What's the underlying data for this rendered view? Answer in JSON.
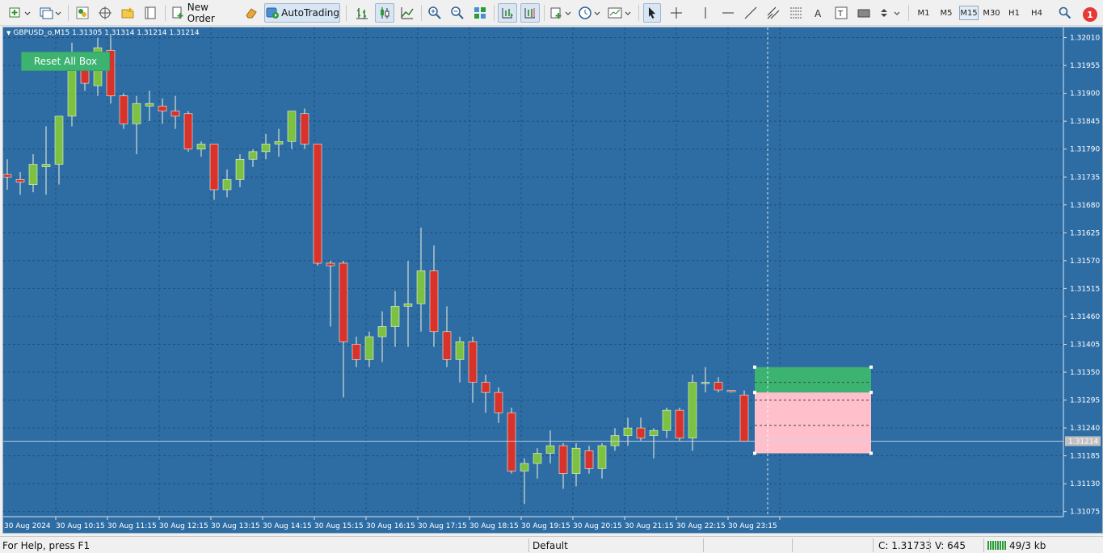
{
  "toolbar": {
    "new_order_label": "New Order",
    "autotrading_label": "AutoTrading",
    "timeframes": [
      "M1",
      "M5",
      "M15",
      "M30",
      "H1",
      "H4"
    ],
    "active_timeframe": "M15",
    "alert_count": "1"
  },
  "chart": {
    "symbol_info": "GBPUSD_o,M15  1.31305 1.31314 1.31214 1.31214",
    "reset_button_label": "Reset All Box",
    "current_price_label": "1.31214",
    "colors": {
      "background": "#2e6da4",
      "bull": "#7cc242",
      "bear": "#d9322b",
      "grid": "#1f4e7a",
      "tp_box": "#3cb371",
      "sl_box": "#ffc0cb"
    }
  },
  "status": {
    "help": "For Help, press F1",
    "profile": "Default",
    "close": "C: 1.31733",
    "volume": "V: 645",
    "traffic": "49/3 kb"
  },
  "chart_data": {
    "type": "candlestick",
    "symbol": "GBPUSD_o",
    "timeframe": "M15",
    "y_ticks": [
      "1.32010",
      "1.31955",
      "1.31900",
      "1.31845",
      "1.31790",
      "1.31735",
      "1.31680",
      "1.31625",
      "1.31570",
      "1.31515",
      "1.31460",
      "1.31405",
      "1.31350",
      "1.31295",
      "1.31240",
      "1.31185",
      "1.31130",
      "1.31075"
    ],
    "x_ticks": [
      "30 Aug 2024",
      "30 Aug 10:15",
      "30 Aug 11:15",
      "30 Aug 12:15",
      "30 Aug 13:15",
      "30 Aug 14:15",
      "30 Aug 15:15",
      "30 Aug 16:15",
      "30 Aug 17:15",
      "30 Aug 18:15",
      "30 Aug 19:15",
      "30 Aug 20:15",
      "30 Aug 21:15",
      "30 Aug 22:15",
      "30 Aug 23:15"
    ],
    "ylim": [
      1.3107,
      1.3202
    ],
    "candles": [
      {
        "o": 1.3174,
        "h": 1.3177,
        "l": 1.3171,
        "c": 1.31735
      },
      {
        "o": 1.3173,
        "h": 1.31745,
        "l": 1.317,
        "c": 1.31725
      },
      {
        "o": 1.3172,
        "h": 1.3178,
        "l": 1.31705,
        "c": 1.3176
      },
      {
        "o": 1.31755,
        "h": 1.31835,
        "l": 1.317,
        "c": 1.3176
      },
      {
        "o": 1.3176,
        "h": 1.3184,
        "l": 1.3172,
        "c": 1.31855
      },
      {
        "o": 1.31855,
        "h": 1.32,
        "l": 1.31835,
        "c": 1.3196
      },
      {
        "o": 1.3196,
        "h": 1.3197,
        "l": 1.31905,
        "c": 1.3192
      },
      {
        "o": 1.31915,
        "h": 1.3201,
        "l": 1.31895,
        "c": 1.3199
      },
      {
        "o": 1.31985,
        "h": 1.32015,
        "l": 1.3188,
        "c": 1.31895
      },
      {
        "o": 1.31895,
        "h": 1.319,
        "l": 1.3183,
        "c": 1.3184
      },
      {
        "o": 1.3184,
        "h": 1.31895,
        "l": 1.3178,
        "c": 1.3188
      },
      {
        "o": 1.31875,
        "h": 1.31905,
        "l": 1.31845,
        "c": 1.3188
      },
      {
        "o": 1.31875,
        "h": 1.3189,
        "l": 1.3184,
        "c": 1.31865
      },
      {
        "o": 1.31865,
        "h": 1.31895,
        "l": 1.3183,
        "c": 1.31855
      },
      {
        "o": 1.3186,
        "h": 1.31865,
        "l": 1.31785,
        "c": 1.3179
      },
      {
        "o": 1.3179,
        "h": 1.31805,
        "l": 1.31775,
        "c": 1.318
      },
      {
        "o": 1.318,
        "h": 1.318,
        "l": 1.3169,
        "c": 1.3171
      },
      {
        "o": 1.3171,
        "h": 1.3175,
        "l": 1.31695,
        "c": 1.3173
      },
      {
        "o": 1.3173,
        "h": 1.3178,
        "l": 1.31715,
        "c": 1.3177
      },
      {
        "o": 1.3177,
        "h": 1.3179,
        "l": 1.31755,
        "c": 1.31785
      },
      {
        "o": 1.31785,
        "h": 1.3182,
        "l": 1.3177,
        "c": 1.318
      },
      {
        "o": 1.318,
        "h": 1.3183,
        "l": 1.31775,
        "c": 1.31805
      },
      {
        "o": 1.31805,
        "h": 1.31865,
        "l": 1.3179,
        "c": 1.31865
      },
      {
        "o": 1.3186,
        "h": 1.3187,
        "l": 1.3179,
        "c": 1.318
      },
      {
        "o": 1.318,
        "h": 1.318,
        "l": 1.3156,
        "c": 1.31565
      },
      {
        "o": 1.31565,
        "h": 1.3157,
        "l": 1.3144,
        "c": 1.3156
      },
      {
        "o": 1.31565,
        "h": 1.3157,
        "l": 1.313,
        "c": 1.3141
      },
      {
        "o": 1.31405,
        "h": 1.3142,
        "l": 1.3136,
        "c": 1.31375
      },
      {
        "o": 1.31375,
        "h": 1.3143,
        "l": 1.3136,
        "c": 1.3142
      },
      {
        "o": 1.3142,
        "h": 1.3147,
        "l": 1.3137,
        "c": 1.3144
      },
      {
        "o": 1.3144,
        "h": 1.3151,
        "l": 1.314,
        "c": 1.3148
      },
      {
        "o": 1.3148,
        "h": 1.3157,
        "l": 1.314,
        "c": 1.31485
      },
      {
        "o": 1.31485,
        "h": 1.31635,
        "l": 1.3143,
        "c": 1.3155
      },
      {
        "o": 1.3155,
        "h": 1.316,
        "l": 1.314,
        "c": 1.3143
      },
      {
        "o": 1.3143,
        "h": 1.3148,
        "l": 1.3136,
        "c": 1.31375
      },
      {
        "o": 1.31375,
        "h": 1.3142,
        "l": 1.3133,
        "c": 1.3141
      },
      {
        "o": 1.3141,
        "h": 1.3142,
        "l": 1.3129,
        "c": 1.3133
      },
      {
        "o": 1.3133,
        "h": 1.31345,
        "l": 1.3127,
        "c": 1.3131
      },
      {
        "o": 1.3131,
        "h": 1.3132,
        "l": 1.3125,
        "c": 1.3127
      },
      {
        "o": 1.3127,
        "h": 1.3128,
        "l": 1.3115,
        "c": 1.31155
      },
      {
        "o": 1.31155,
        "h": 1.3118,
        "l": 1.3109,
        "c": 1.3117
      },
      {
        "o": 1.3117,
        "h": 1.312,
        "l": 1.3114,
        "c": 1.3119
      },
      {
        "o": 1.3119,
        "h": 1.31235,
        "l": 1.3117,
        "c": 1.31205
      },
      {
        "o": 1.31205,
        "h": 1.3121,
        "l": 1.3112,
        "c": 1.3115
      },
      {
        "o": 1.3115,
        "h": 1.3121,
        "l": 1.31125,
        "c": 1.312
      },
      {
        "o": 1.31195,
        "h": 1.31205,
        "l": 1.3115,
        "c": 1.3116
      },
      {
        "o": 1.3116,
        "h": 1.3121,
        "l": 1.3114,
        "c": 1.31205
      },
      {
        "o": 1.31205,
        "h": 1.3124,
        "l": 1.31195,
        "c": 1.31225
      },
      {
        "o": 1.31225,
        "h": 1.3126,
        "l": 1.31205,
        "c": 1.3124
      },
      {
        "o": 1.3124,
        "h": 1.3126,
        "l": 1.31215,
        "c": 1.3122
      },
      {
        "o": 1.31225,
        "h": 1.3124,
        "l": 1.3118,
        "c": 1.31235
      },
      {
        "o": 1.31235,
        "h": 1.3128,
        "l": 1.3122,
        "c": 1.31275
      },
      {
        "o": 1.31275,
        "h": 1.3128,
        "l": 1.31215,
        "c": 1.3122
      },
      {
        "o": 1.3122,
        "h": 1.31345,
        "l": 1.31195,
        "c": 1.3133
      },
      {
        "o": 1.3133,
        "h": 1.3136,
        "l": 1.3131,
        "c": 1.3133
      },
      {
        "o": 1.3133,
        "h": 1.3134,
        "l": 1.3131,
        "c": 1.31315
      },
      {
        "o": 1.31314,
        "h": 1.31314,
        "l": 1.3131,
        "c": 1.31312
      },
      {
        "o": 1.31305,
        "h": 1.31314,
        "l": 1.31214,
        "c": 1.31214
      }
    ],
    "trade_box": {
      "take_profit_top": 1.3136,
      "entry": 1.3131,
      "stop_loss_bottom": 1.3119
    }
  }
}
